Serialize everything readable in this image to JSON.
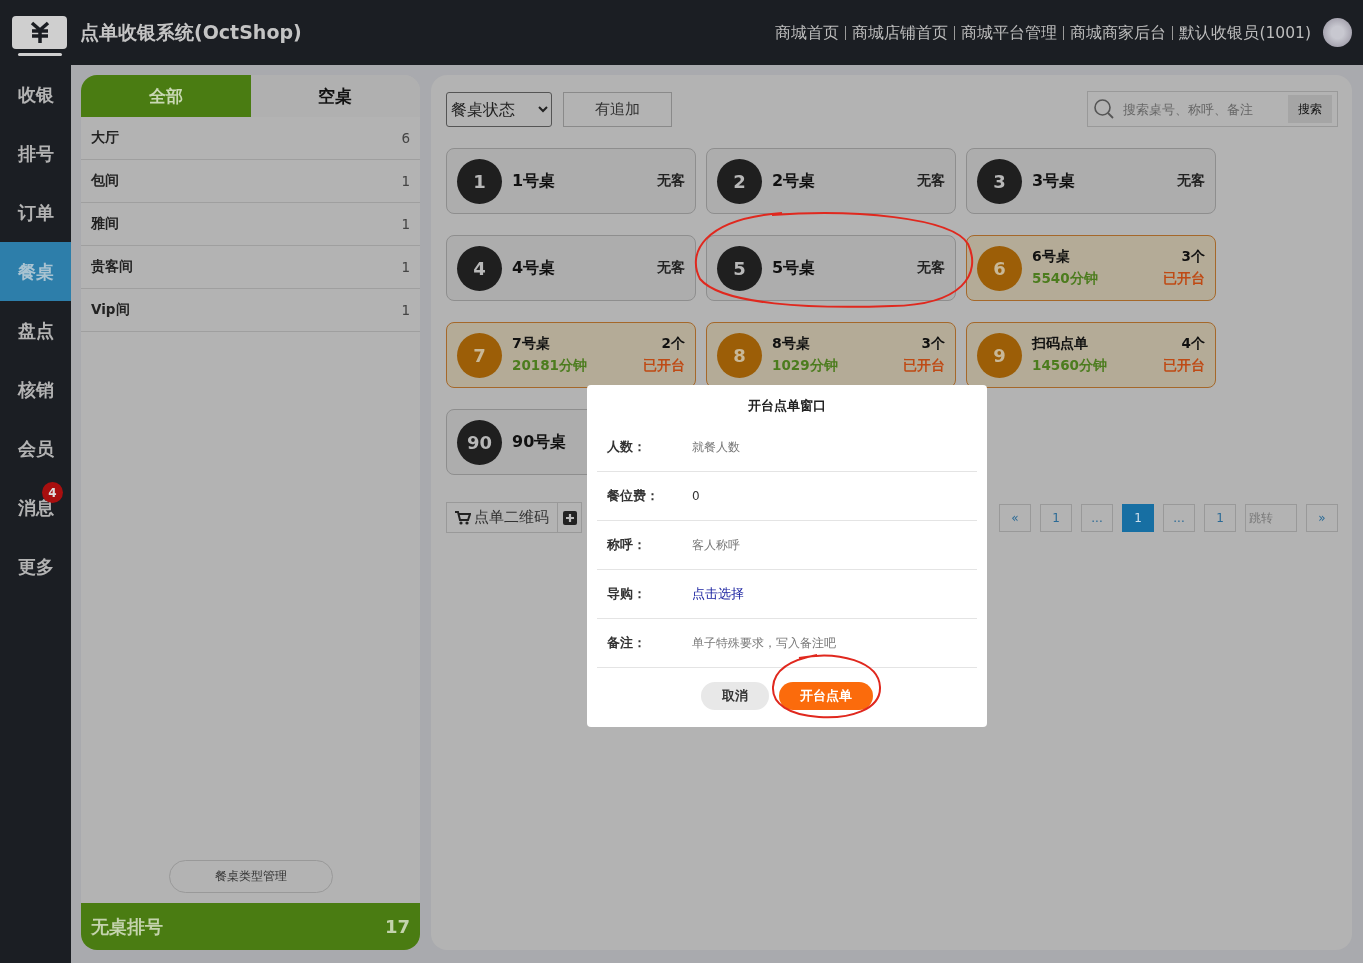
{
  "header": {
    "title": "点单收银系统(OctShop)",
    "links": [
      "商城首页",
      "商城店铺首页",
      "商城平台管理",
      "商城商家后台",
      "默认收银员(1001)"
    ]
  },
  "nav": [
    {
      "label": "收银",
      "selected": false
    },
    {
      "label": "排号",
      "selected": false
    },
    {
      "label": "订单",
      "selected": false
    },
    {
      "label": "餐桌",
      "selected": true
    },
    {
      "label": "盘点",
      "selected": false
    },
    {
      "label": "核销",
      "selected": false
    },
    {
      "label": "会员",
      "selected": false
    },
    {
      "label": "消息",
      "selected": false,
      "badge": "4"
    },
    {
      "label": "更多",
      "selected": false
    }
  ],
  "areas": {
    "tabs": [
      {
        "label": "全部",
        "selected": true
      },
      {
        "label": "空桌",
        "selected": false
      }
    ],
    "items": [
      {
        "name": "大厅",
        "count": "6"
      },
      {
        "name": "包间",
        "count": "1"
      },
      {
        "name": "雅间",
        "count": "1"
      },
      {
        "name": "贵客间",
        "count": "1"
      },
      {
        "name": "Vip间",
        "count": "1"
      }
    ],
    "manage_button": "餐桌类型管理",
    "queue": {
      "label": "无桌排号",
      "count": "17"
    }
  },
  "toolbar": {
    "status_select": "餐桌状态",
    "filter_button": "有追加",
    "search_placeholder": "搜索桌号、称呼、备注",
    "search_button": "搜索"
  },
  "tables": [
    {
      "kind": "empty",
      "number": "1",
      "name": "1号桌",
      "status": "无客"
    },
    {
      "kind": "empty",
      "number": "2",
      "name": "2号桌",
      "status": "无客"
    },
    {
      "kind": "empty",
      "number": "3",
      "name": "3号桌",
      "status": "无客"
    },
    {
      "kind": "empty",
      "number": "4",
      "name": "4号桌",
      "status": "无客"
    },
    {
      "kind": "empty",
      "number": "5",
      "name": "5号桌",
      "status": "无客"
    },
    {
      "kind": "open",
      "number": "6",
      "name": "6号桌",
      "count": "3个",
      "duration": "5540分钟",
      "status": "已开台"
    },
    {
      "kind": "open",
      "number": "7",
      "name": "7号桌",
      "count": "2个",
      "duration": "20181分钟",
      "status": "已开台"
    },
    {
      "kind": "open",
      "number": "8",
      "name": "8号桌",
      "count": "3个",
      "duration": "1029分钟",
      "status": "已开台"
    },
    {
      "kind": "open",
      "number": "9",
      "name": "扫码点单",
      "count": "4个",
      "duration": "14560分钟",
      "status": "已开台"
    },
    {
      "kind": "empty",
      "number": "90",
      "name": "90号桌"
    }
  ],
  "qr_button": "点单二维码",
  "pagination": {
    "pages": [
      {
        "label": "«",
        "selected": false
      },
      {
        "label": "1",
        "selected": false
      },
      {
        "label": "...",
        "selected": false
      },
      {
        "label": "1",
        "selected": true
      },
      {
        "label": "...",
        "selected": false
      },
      {
        "label": "1",
        "selected": false
      }
    ],
    "jump_placeholder": "跳转",
    "next": "»"
  },
  "modal": {
    "title": "开台点单窗口",
    "fields": [
      {
        "label": "人数：",
        "kind": "input",
        "placeholder": "就餐人数"
      },
      {
        "label": "餐位费：",
        "kind": "input",
        "value": "0"
      },
      {
        "label": "称呼：",
        "kind": "input",
        "placeholder": "客人称呼"
      },
      {
        "label": "导购：",
        "kind": "link",
        "value": "点击选择"
      },
      {
        "label": "备注：",
        "kind": "input",
        "placeholder": "单子特殊要求，写入备注吧"
      }
    ],
    "cancel": "取消",
    "confirm": "开台点单"
  }
}
